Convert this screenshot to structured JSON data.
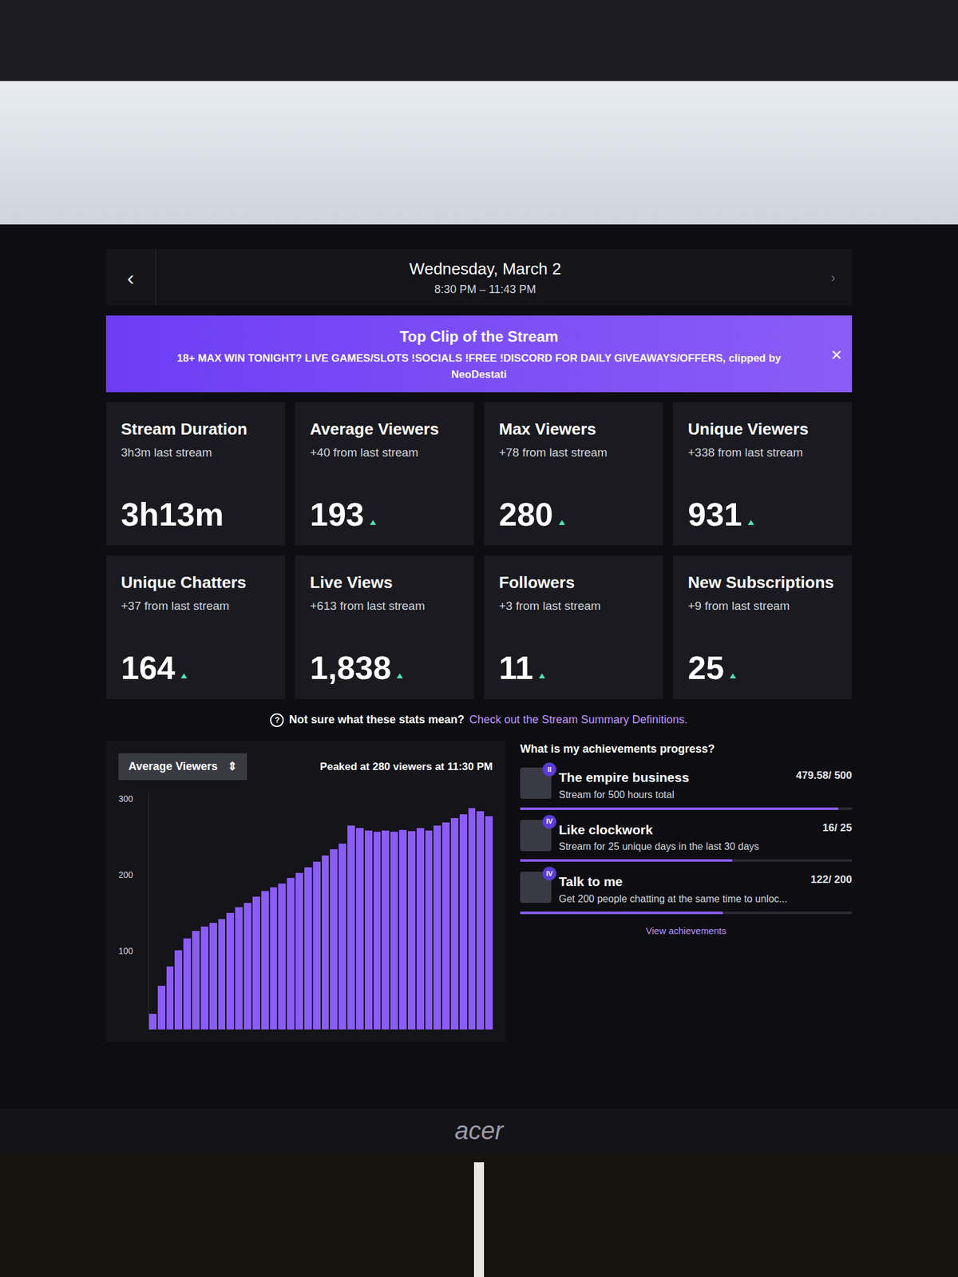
{
  "header": {
    "back": "‹",
    "date": "Wednesday, March 2",
    "time": "8:30 PM – 11:43 PM",
    "next": "›"
  },
  "banner": {
    "title": "Top Clip of the Stream",
    "clip": "18+ MAX WIN TONIGHT? LIVE GAMES/SLOTS !SOCIALS !FREE !DISCORD FOR DAILY GIVEAWAYS/OFFERS, clipped by NeoDestati",
    "close": "×"
  },
  "stats": [
    {
      "label": "Stream Duration",
      "sub": "3h3m last stream",
      "value": "3h13m",
      "up": false
    },
    {
      "label": "Average Viewers",
      "sub": "+40 from last stream",
      "value": "193",
      "up": true
    },
    {
      "label": "Max Viewers",
      "sub": "+78 from last stream",
      "value": "280",
      "up": true
    },
    {
      "label": "Unique Viewers",
      "sub": "+338 from last stream",
      "value": "931",
      "up": true
    },
    {
      "label": "Unique Chatters",
      "sub": "+37 from last stream",
      "value": "164",
      "up": true
    },
    {
      "label": "Live Views",
      "sub": "+613 from last stream",
      "value": "1,838",
      "up": true
    },
    {
      "label": "Followers",
      "sub": "+3 from last stream",
      "value": "11",
      "up": true
    },
    {
      "label": "New Subscriptions",
      "sub": "+9 from last stream",
      "value": "25",
      "up": true
    }
  ],
  "help": {
    "icon": "?",
    "text": "Not sure what these stats mean?",
    "link": "Check out the Stream Summary Definitions."
  },
  "chart": {
    "selector": "Average Viewers",
    "selector_icon": "⇕",
    "peak": "Peaked at 280 viewers at 11:30 PM",
    "ticks": [
      "300",
      "200",
      "100"
    ],
    "max": 300,
    "values": [
      20,
      55,
      80,
      100,
      115,
      125,
      130,
      135,
      140,
      148,
      155,
      160,
      168,
      175,
      180,
      185,
      192,
      198,
      205,
      212,
      220,
      228,
      235,
      258,
      255,
      252,
      250,
      252,
      250,
      253,
      251,
      255,
      252,
      258,
      262,
      268,
      272,
      280,
      276,
      270
    ]
  },
  "achievements": {
    "title": "What is my achievements progress?",
    "link": "View achievements",
    "items": [
      {
        "name": "The empire business",
        "desc": "Stream for 500 hours total",
        "progress": "479.58/ 500",
        "level": 0.959,
        "badge": "II"
      },
      {
        "name": "Like clockwork",
        "desc": "Stream for 25 unique days in the last 30 days",
        "progress": "16/ 25",
        "level": 0.64,
        "badge": "IV"
      },
      {
        "name": "Talk to me",
        "desc": "Get 200 people chatting at the same time to unloc...",
        "progress": "122/ 200",
        "level": 0.61,
        "badge": "IV"
      }
    ]
  },
  "monitor": {
    "brand": "acer"
  }
}
